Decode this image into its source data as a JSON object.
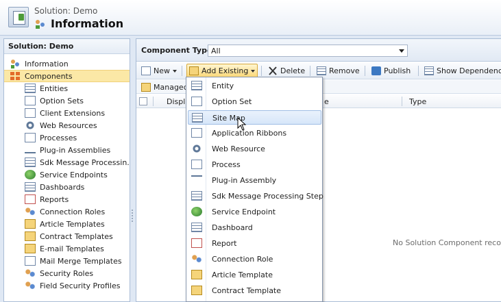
{
  "header": {
    "solution_label": "Solution: Demo",
    "title": "Information"
  },
  "leftnav": {
    "heading": "Solution: Demo",
    "items": [
      {
        "label": "Information",
        "icon": "information-icon"
      },
      {
        "label": "Components",
        "icon": "components-icon",
        "selected": true
      }
    ],
    "subitems": [
      {
        "label": "Entities",
        "icon": "entity-icon"
      },
      {
        "label": "Option Sets",
        "icon": "option-set-icon"
      },
      {
        "label": "Client Extensions",
        "icon": "client-extensions-icon"
      },
      {
        "label": "Web Resources",
        "icon": "web-resource-icon"
      },
      {
        "label": "Processes",
        "icon": "process-icon"
      },
      {
        "label": "Plug-in Assemblies",
        "icon": "plugin-icon"
      },
      {
        "label": "Sdk Message Processin...",
        "icon": "sdk-message-icon"
      },
      {
        "label": "Service Endpoints",
        "icon": "service-endpoint-icon"
      },
      {
        "label": "Dashboards",
        "icon": "dashboard-icon"
      },
      {
        "label": "Reports",
        "icon": "report-icon"
      },
      {
        "label": "Connection Roles",
        "icon": "connection-role-icon"
      },
      {
        "label": "Article Templates",
        "icon": "article-template-icon"
      },
      {
        "label": "Contract Templates",
        "icon": "contract-template-icon"
      },
      {
        "label": "E-mail Templates",
        "icon": "email-template-icon"
      },
      {
        "label": "Mail Merge Templates",
        "icon": "mail-merge-icon"
      },
      {
        "label": "Security Roles",
        "icon": "security-role-icon"
      },
      {
        "label": "Field Security Profiles",
        "icon": "field-security-icon"
      }
    ]
  },
  "component_type": {
    "label": "Component Type",
    "value": "All"
  },
  "toolbar": {
    "new_label": "New",
    "add_existing_label": "Add Existing",
    "delete_label": "Delete",
    "remove_label": "Remove",
    "publish_label": "Publish",
    "show_dependencies_label": "Show Dependenci"
  },
  "toolbar2": {
    "managed_label": "Managed"
  },
  "grid": {
    "col_display": "Displ",
    "col_mid": "e",
    "col_type": "Type",
    "empty_message": "No Solution Component recor"
  },
  "menu": {
    "items": [
      {
        "label": "Entity",
        "icon": "entity-icon"
      },
      {
        "label": "Option Set",
        "icon": "option-set-icon"
      },
      {
        "label": "Site Map",
        "icon": "site-map-icon",
        "hover": true
      },
      {
        "label": "Application Ribbons",
        "icon": "ribbon-icon"
      },
      {
        "label": "Web Resource",
        "icon": "web-resource-icon"
      },
      {
        "label": "Process",
        "icon": "process-icon"
      },
      {
        "label": "Plug-in Assembly",
        "icon": "plugin-icon"
      },
      {
        "label": "Sdk Message Processing Step",
        "icon": "sdk-message-icon"
      },
      {
        "label": "Service Endpoint",
        "icon": "service-endpoint-icon"
      },
      {
        "label": "Dashboard",
        "icon": "dashboard-icon"
      },
      {
        "label": "Report",
        "icon": "report-icon"
      },
      {
        "label": "Connection Role",
        "icon": "connection-role-icon"
      },
      {
        "label": "Article Template",
        "icon": "article-template-icon"
      },
      {
        "label": "Contract Template",
        "icon": "contract-template-icon"
      }
    ]
  }
}
